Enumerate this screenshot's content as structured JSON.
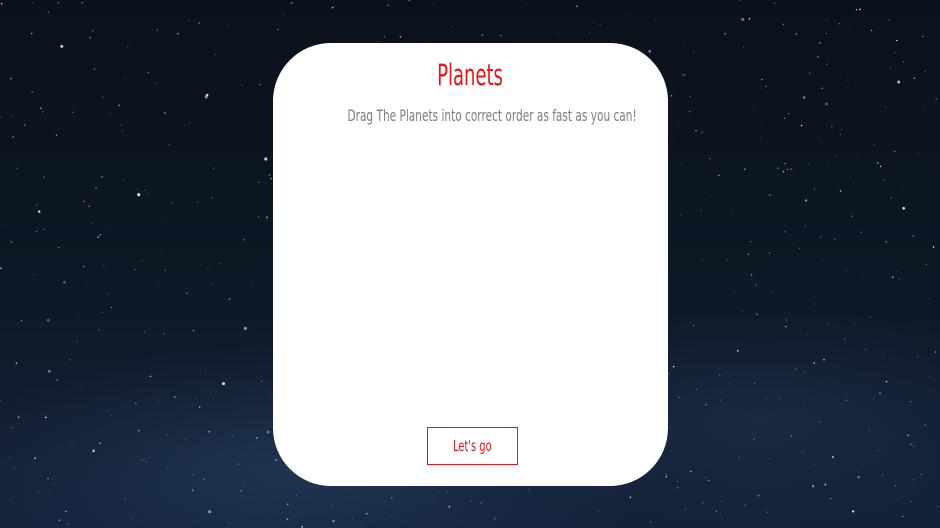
{
  "game": {
    "title": "Planets",
    "instructions": "Drag The Planets into correct order as fast as you can!",
    "start_button_label": "Let's go"
  },
  "colors": {
    "accent": "#e8141a",
    "text_muted": "#7d7d7d",
    "card_background": "#ffffff",
    "page_background": "#0c1420"
  },
  "background": {
    "type": "starry-night-sky"
  }
}
